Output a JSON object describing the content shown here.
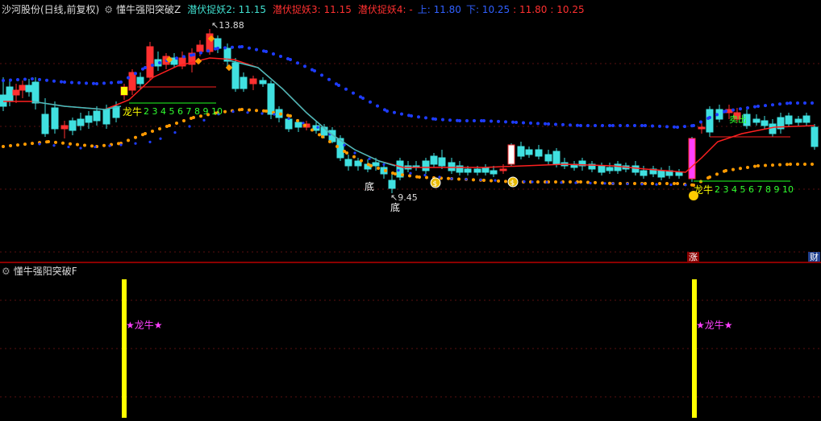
{
  "top_header": {
    "stock": "沙河股份(日线,前复权)",
    "gear_icon": "gear-icon",
    "indicator": "懂牛强阳突破Z",
    "v2": "潜伏捉妖2: 11.15",
    "v3": "潜伏捉妖3: 11.15",
    "v4": "潜伏捉妖4: -",
    "up": "上: 11.80",
    "down": "下: 10.25",
    "c1": ": 11.80",
    "c2": ": 10.25"
  },
  "annotations": {
    "high": "13.88",
    "low": "9.45",
    "bottom1": "底",
    "bottom2": "底",
    "dragon1": "龙牛",
    "dragon2": "龙牛",
    "count1": "2 3 4 5 6 7 8 9 10",
    "count2": "2 3 4 5 6 7 8 9 10",
    "sell": "卖出"
  },
  "bottom_header": {
    "indicator": "懂牛强阳突破F"
  },
  "bottom_labels": {
    "star1": "★龙牛★",
    "star2": "★龙牛★"
  },
  "tags": {
    "zhang": "涨",
    "cai": "财"
  },
  "colors": {
    "up": "#ff3030",
    "down": "#40e0e0",
    "ma": "#ff2020",
    "ma_alt": "#40c0c0",
    "dots_upper": "#1e3cff",
    "dots_lower": "#ff9a00",
    "signal_bar": "#ffff00",
    "magenta": "#ff40ff"
  }
}
